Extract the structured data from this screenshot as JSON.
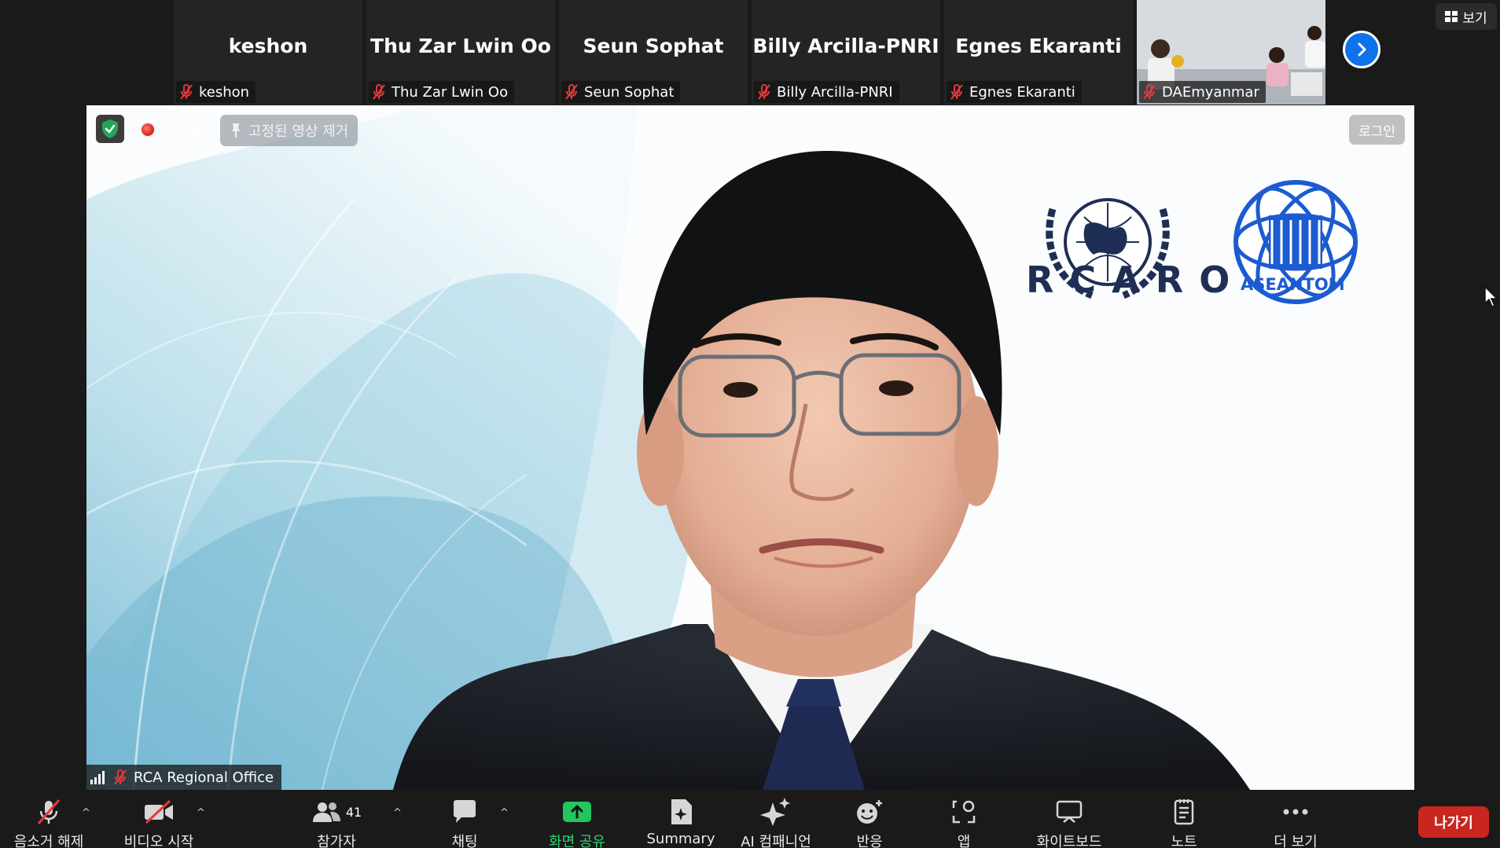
{
  "gallery": {
    "tiles": [
      {
        "display_name": "keshon",
        "tag_name": "keshon"
      },
      {
        "display_name": "Thu Zar Lwin Oo",
        "tag_name": "Thu Zar Lwin Oo"
      },
      {
        "display_name": "Seun Sophat",
        "tag_name": "Seun Sophat"
      },
      {
        "display_name": "Billy Arcilla-PNRI",
        "tag_name": "Billy Arcilla-PNRI"
      },
      {
        "display_name": "Egnes Ekaranti",
        "tag_name": "Egnes Ekaranti"
      }
    ],
    "video_tile": {
      "tag_name": "DAEmyanmar"
    },
    "view_label": "보기"
  },
  "stage": {
    "recording_label": "기록 중",
    "unpin_label": "고정된 영상 제거",
    "login_label": "로그인",
    "speaker_name": "RCA Regional Office",
    "logos": {
      "rcaro": "RCARO",
      "aseantom": "ASEANTOM"
    }
  },
  "toolbar": {
    "unmute": "음소거 해제",
    "start_video": "비디오 시작",
    "participants": "참가자",
    "participants_count": "41",
    "chat": "채팅",
    "share_screen": "화면 공유",
    "summary": "Summary",
    "ai_companion": "AI 컴패니언",
    "reactions": "반응",
    "apps": "앱",
    "whiteboard": "화이트보드",
    "notes": "노트",
    "more": "더 보기",
    "leave": "나가기"
  },
  "colors": {
    "accent_blue": "#0e72ed",
    "share_green": "#22c55e",
    "leave_red": "#c8261e",
    "mute_red": "#e5393a"
  }
}
